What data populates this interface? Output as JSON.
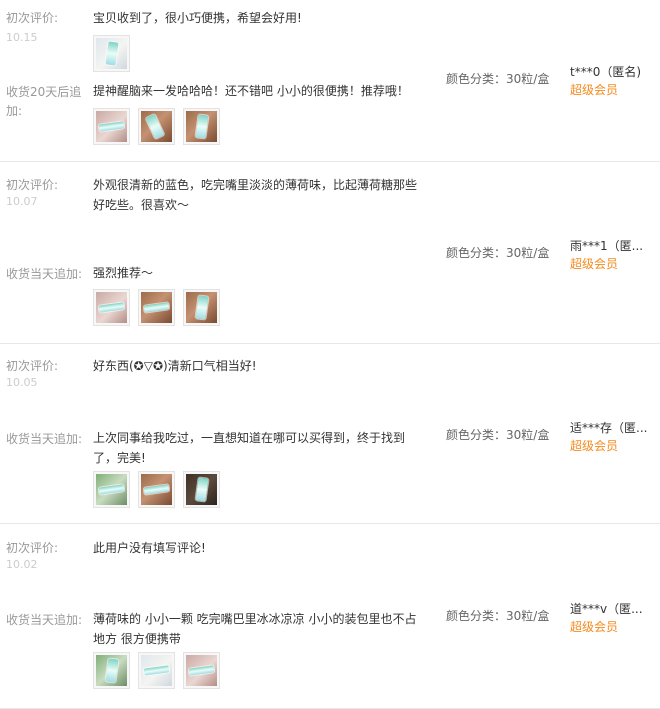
{
  "reviews": [
    {
      "initial_label": "初次评价:",
      "initial_date": "10.15",
      "initial_text": "宝贝收到了，很小巧便携，希望会好用!",
      "follow_label": "收货20天后追加:",
      "follow_text": "提神醒脑来一发哈哈哈！还不错吧 小小的很便携！推荐哦！",
      "color_label": "颜色分类：30粒/盒",
      "user": "t***0（匿名)",
      "membership": "超级会员"
    },
    {
      "initial_label": "初次评价:",
      "initial_date": "10.07",
      "initial_text": "外观很清新的蓝色，吃完嘴里淡淡的薄荷味，比起薄荷糖那些好吃些。很喜欢～",
      "follow_label": "收货当天追加:",
      "follow_text": "强烈推荐～",
      "color_label": "颜色分类：30粒/盒",
      "user": "雨***1（匿...",
      "membership": "超级会员"
    },
    {
      "initial_label": "初次评价:",
      "initial_date": "10.05",
      "initial_text": "好东西(✪▽✪)清新口气相当好!",
      "follow_label": "收货当天追加:",
      "follow_text": "上次同事给我吃过，一直想知道在哪可以买得到，终于找到了，完美!",
      "color_label": "颜色分类：30粒/盒",
      "user": "适***存（匿...",
      "membership": "超级会员"
    },
    {
      "initial_label": "初次评价:",
      "initial_date": "10.02",
      "initial_text": "此用户没有填写评论!",
      "follow_label": "收货当天追加:",
      "follow_text": "薄荷味的 小小一颗 吃完嘴巴里冰冰凉凉 小小的装包里也不占地方 很方便携带",
      "color_label": "颜色分类：30粒/盒",
      "user": "道***v（匿...",
      "membership": "超级会员"
    }
  ]
}
